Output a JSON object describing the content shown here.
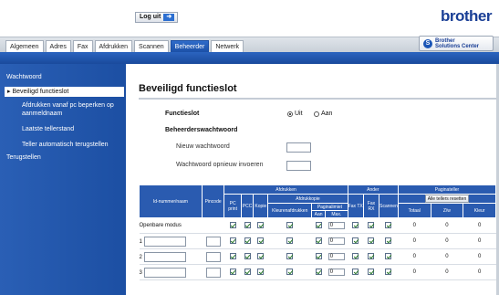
{
  "header": {
    "logout_label": "Log uit",
    "brand": "brother"
  },
  "tabs": [
    "Algemeen",
    "Adres",
    "Fax",
    "Afdrukken",
    "Scannen",
    "Beheerder",
    "Netwerk"
  ],
  "active_tab": "Beheerder",
  "solutions_center": {
    "line1": "Brother",
    "line2": "Solutions Center"
  },
  "sidebar": {
    "items": [
      {
        "label": "Wachtwoord"
      },
      {
        "label": "Beveiligd functieslot",
        "selected": true
      },
      {
        "label": "Afdrukken vanaf pc beperken op"
      },
      {
        "label": "aanmeldnaam"
      },
      {
        "label": "Laatste tellerstand"
      },
      {
        "label": "Teller automatisch terugstellen"
      },
      {
        "label": "Terugstellen"
      }
    ]
  },
  "main": {
    "title": "Beveiligd functieslot",
    "functieslot_label": "Functieslot",
    "radio_off": "Uit",
    "radio_on": "Aan",
    "radio_selected": "Uit",
    "admin_pw_label": "Beheerderswachtwoord",
    "new_pw_label": "Nieuw wachtwoord",
    "repeat_pw_label": "Wachtwoord opnieuw invoeren"
  },
  "table": {
    "header": {
      "id": "Id-nummer/naam",
      "pin": "Pincode",
      "afdrukken": "Afdrukken",
      "ander": "Ander",
      "paginateller": "Paginateller",
      "pc_print": "PC print",
      "pcc": "PCC",
      "kopie": "Kopie",
      "afdrukkopie": "Afdrukkopie",
      "kleurenafdrukken": "Kleurenafdrukken",
      "paginalimiet": "Paginalimiet",
      "aan": "Aan",
      "max": "Max.",
      "fax_tx": "Fax TX",
      "fax_rx": "Fax RX",
      "scannen": "Scannen",
      "reset_all": "Alle tellers resetten",
      "totaal": "Totaal",
      "zw": "Z/w",
      "kleur": "Kleur"
    },
    "rows": [
      {
        "label": "Openbare modus",
        "max": "0",
        "totaal": "0",
        "zw": "0",
        "kleur": "0"
      },
      {
        "label": "1",
        "max": "0",
        "totaal": "0",
        "zw": "0",
        "kleur": "0"
      },
      {
        "label": "2",
        "max": "0",
        "totaal": "0",
        "zw": "0",
        "kleur": "0"
      },
      {
        "label": "3",
        "max": "0",
        "totaal": "0",
        "zw": "0",
        "kleur": "0"
      }
    ]
  }
}
